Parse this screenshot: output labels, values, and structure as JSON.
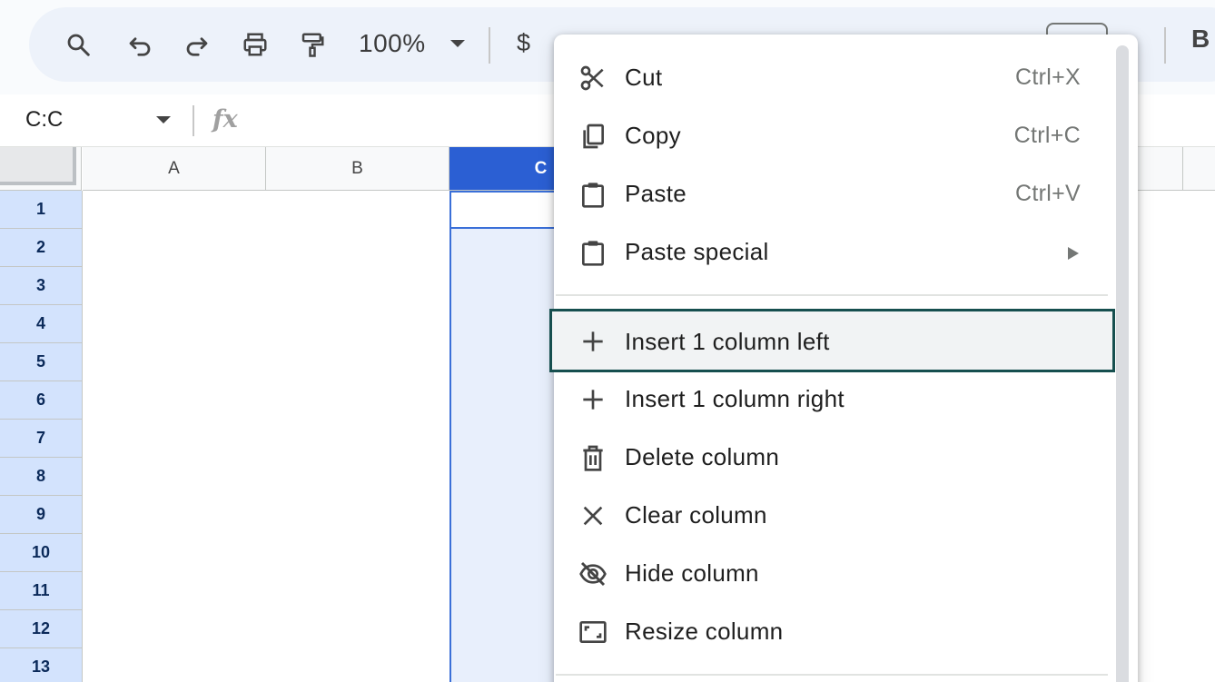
{
  "toolbar": {
    "zoom": "100%",
    "currency_symbol": "$",
    "bold_label": "B"
  },
  "formula_bar": {
    "name_box": "C:C",
    "fx_label": "fx"
  },
  "grid": {
    "columns": [
      "A",
      "B",
      "C"
    ],
    "rows": [
      "1",
      "2",
      "3",
      "4",
      "5",
      "6",
      "7",
      "8",
      "9",
      "10",
      "11",
      "12",
      "13"
    ],
    "selected_column": "C"
  },
  "context_menu": {
    "items": [
      {
        "label": "Cut",
        "shortcut": "Ctrl+X",
        "icon": "scissors-icon"
      },
      {
        "label": "Copy",
        "shortcut": "Ctrl+C",
        "icon": "copy-icon"
      },
      {
        "label": "Paste",
        "shortcut": "Ctrl+V",
        "icon": "clipboard-icon"
      },
      {
        "label": "Paste special",
        "shortcut": "",
        "icon": "clipboard-icon"
      },
      {
        "label": "Insert 1 column left",
        "shortcut": "",
        "icon": "plus-icon"
      },
      {
        "label": "Insert 1 column right",
        "shortcut": "",
        "icon": "plus-icon"
      },
      {
        "label": "Delete column",
        "shortcut": "",
        "icon": "trash-icon"
      },
      {
        "label": "Clear column",
        "shortcut": "",
        "icon": "close-icon"
      },
      {
        "label": "Hide column",
        "shortcut": "",
        "icon": "eye-off-icon"
      },
      {
        "label": "Resize column",
        "shortcut": "",
        "icon": "resize-icon"
      }
    ],
    "highlighted_item": "Insert 1 column left"
  },
  "colors": {
    "selected_header": "#2b5fd3",
    "row_header": "#d3e3fd",
    "highlight_border": "#164f4f"
  }
}
